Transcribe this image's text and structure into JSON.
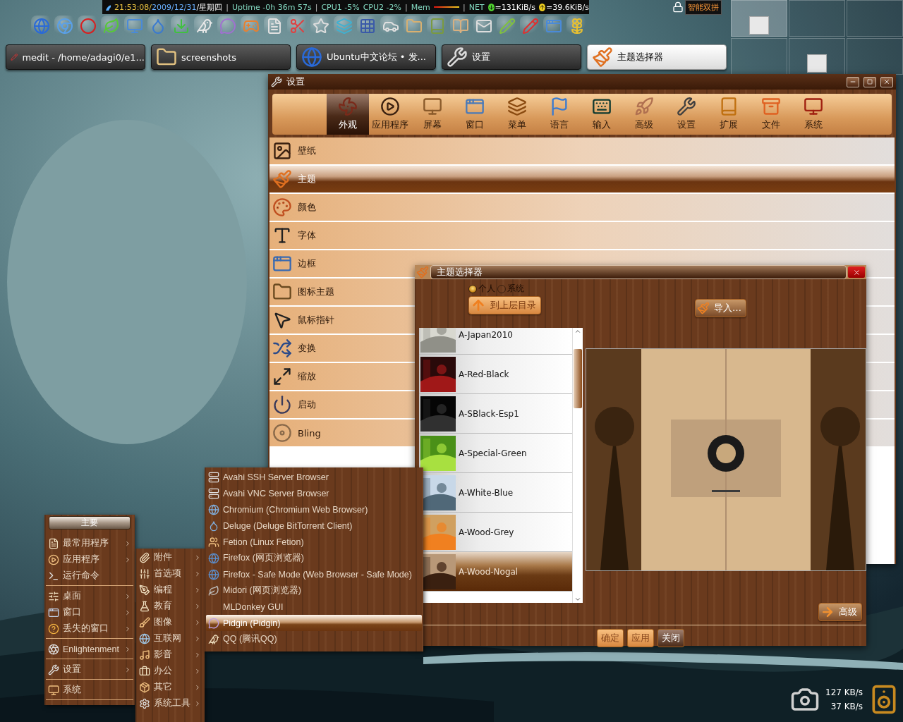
{
  "top_bar": {
    "segments": [
      {
        "kind": "time",
        "text": "21:53:08/"
      },
      {
        "kind": "date",
        "text": "2009/12/31"
      },
      {
        "kind": "text",
        "text": "/星期四"
      },
      {
        "kind": "sep",
        "text": "|"
      },
      {
        "kind": "label",
        "text": "Uptime -0h 36m 57s"
      },
      {
        "kind": "sep",
        "text": "|"
      },
      {
        "kind": "label",
        "text": "CPU1 -5%"
      },
      {
        "kind": "label",
        "text": "CPU2 -2%"
      },
      {
        "kind": "sep",
        "text": "|"
      },
      {
        "kind": "label",
        "text": "Mem"
      },
      {
        "kind": "meter",
        "level": 1
      },
      {
        "kind": "sep",
        "text": "|"
      },
      {
        "kind": "label",
        "text": "NET"
      },
      {
        "kind": "down",
        "text": "=131KiB/s"
      },
      {
        "kind": "up",
        "text": "=39.6KiB/s"
      }
    ]
  },
  "input_method": {
    "label": "智能双拼"
  },
  "taskbar": {
    "tasks": [
      {
        "label": "medit - /home/adagi0/e1...",
        "selected": false
      },
      {
        "label": "screenshots",
        "selected": false
      },
      {
        "label": "Ubuntu中文论坛 • 发...",
        "selected": false
      },
      {
        "label": "设置",
        "selected": false
      },
      {
        "label": "主题选择器",
        "selected": true
      }
    ]
  },
  "settings_window": {
    "title": "设置",
    "tabs": [
      {
        "label": "外观",
        "selected": true
      },
      {
        "label": "应用程序",
        "selected": false
      },
      {
        "label": "屏幕",
        "selected": false
      },
      {
        "label": "窗口",
        "selected": false
      },
      {
        "label": "菜单",
        "selected": false
      },
      {
        "label": "语言",
        "selected": false
      },
      {
        "label": "输入",
        "selected": false
      },
      {
        "label": "高级",
        "selected": false
      },
      {
        "label": "设置",
        "selected": false
      },
      {
        "label": "扩展",
        "selected": false
      },
      {
        "label": "文件",
        "selected": false
      },
      {
        "label": "系统",
        "selected": false
      }
    ],
    "items": [
      {
        "label": "壁纸",
        "selected": false
      },
      {
        "label": "主题",
        "selected": true
      },
      {
        "label": "颜色",
        "selected": false
      },
      {
        "label": "字体",
        "selected": false
      },
      {
        "label": "边框",
        "selected": false
      },
      {
        "label": "图标主题",
        "selected": false
      },
      {
        "label": "鼠标指针",
        "selected": false
      },
      {
        "label": "变换",
        "selected": false
      },
      {
        "label": "缩放",
        "selected": false
      },
      {
        "label": "启动",
        "selected": false
      },
      {
        "label": "Bling",
        "selected": false
      }
    ]
  },
  "theme_window": {
    "title": "主题选择器",
    "scope": [
      {
        "label": "个人",
        "selected": true
      },
      {
        "label": "系统",
        "selected": false
      }
    ],
    "up_button": "到上层目录",
    "import_button": "导入…",
    "themes": [
      {
        "name": "A-Japan2010",
        "selected": false
      },
      {
        "name": "A-Red-Black",
        "selected": false
      },
      {
        "name": "A-SBlack-Esp1",
        "selected": false
      },
      {
        "name": "A-Special-Green",
        "selected": false
      },
      {
        "name": "A-White-Blue",
        "selected": false
      },
      {
        "name": "A-Wood-Grey",
        "selected": false
      },
      {
        "name": "A-Wood-Nogal",
        "selected": true
      }
    ],
    "advanced_button": "高级",
    "buttons": [
      {
        "label": "确定",
        "focused": false
      },
      {
        "label": "应用",
        "focused": false
      },
      {
        "label": "关闭",
        "focused": true
      }
    ]
  },
  "main_menu": {
    "title": "主要",
    "groups": [
      {
        "items": [
          {
            "label": "最常用程序",
            "submenu": true
          },
          {
            "label": "应用程序",
            "submenu": true
          },
          {
            "label": "运行命令",
            "submenu": false
          }
        ]
      },
      {
        "items": [
          {
            "label": "桌面",
            "submenu": true
          },
          {
            "label": "窗口",
            "submenu": true
          },
          {
            "label": "丢失的窗口",
            "submenu": true
          }
        ]
      },
      {
        "items": [
          {
            "label": "Enlightenment",
            "submenu": true
          }
        ]
      },
      {
        "items": [
          {
            "label": "设置",
            "submenu": true
          }
        ]
      },
      {
        "items": [
          {
            "label": "系统",
            "submenu": false
          }
        ]
      }
    ]
  },
  "apps_menu": {
    "items": [
      {
        "label": "附件",
        "submenu": true
      },
      {
        "label": "首选项",
        "submenu": true
      },
      {
        "label": "编程",
        "submenu": true
      },
      {
        "label": "教育",
        "submenu": true
      },
      {
        "label": "图像",
        "submenu": true
      },
      {
        "label": "互联网",
        "submenu": true
      },
      {
        "label": "影音",
        "submenu": true
      },
      {
        "label": "办公",
        "submenu": true
      },
      {
        "label": "其它",
        "submenu": true
      },
      {
        "label": "系统工具",
        "submenu": true
      }
    ]
  },
  "internet_menu": {
    "items": [
      {
        "label": "Avahi SSH Server Browser",
        "selected": false
      },
      {
        "label": "Avahi VNC Server Browser",
        "selected": false
      },
      {
        "label": "Chromium (Chromium Web Browser)",
        "selected": false
      },
      {
        "label": "Deluge (Deluge BitTorrent Client)",
        "selected": false
      },
      {
        "label": "Fetion (Linux Fetion)",
        "selected": false
      },
      {
        "label": "Firefox (网页浏览器)",
        "selected": false
      },
      {
        "label": "Firefox - Safe Mode (Web Browser - Safe Mode)",
        "selected": false
      },
      {
        "label": "Midori (网页浏览器)",
        "selected": false
      },
      {
        "label": "MLDonkey GUI",
        "selected": false
      },
      {
        "label": "Pidgin (Pidgin)",
        "selected": true
      },
      {
        "label": "QQ (腾讯QQ)",
        "selected": false
      }
    ]
  },
  "tray": {
    "speeds": [
      "127 KB/s",
      "37 KB/s"
    ]
  }
}
